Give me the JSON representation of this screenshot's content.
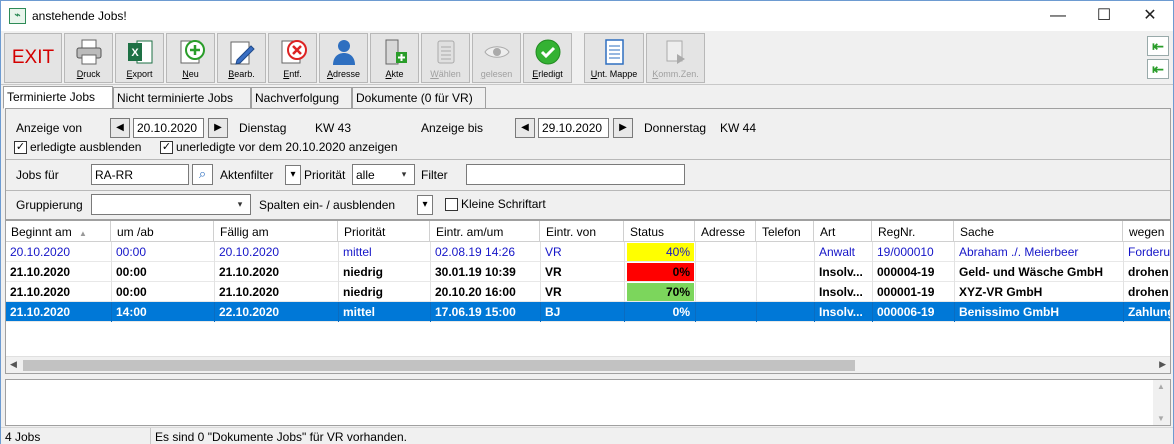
{
  "window": {
    "title": "anstehende Jobs!",
    "minimize_glyph": "—",
    "maximize_glyph": "☐",
    "close_glyph": "✕"
  },
  "toolbar": {
    "exit_label": "EXIT",
    "buttons": [
      {
        "label": "Druck",
        "icon": "printer-icon",
        "enabled": true
      },
      {
        "label": "Export",
        "icon": "excel-icon",
        "enabled": true
      },
      {
        "label": "Neu",
        "icon": "add-icon",
        "enabled": true
      },
      {
        "label": "Bearb.",
        "icon": "edit-icon",
        "enabled": true
      },
      {
        "label": "Entf.",
        "icon": "delete-icon",
        "enabled": true
      },
      {
        "label": "Adresse",
        "icon": "person-icon",
        "enabled": true
      },
      {
        "label": "Akte",
        "icon": "file-add-icon",
        "enabled": true
      },
      {
        "label": "Wählen",
        "icon": "dial-icon",
        "enabled": false
      },
      {
        "label": "gelesen",
        "icon": "eye-icon",
        "enabled": false
      },
      {
        "label": "Erledigt",
        "icon": "check-icon",
        "enabled": true
      },
      {
        "label": "Unt. Mappe",
        "icon": "folder-icon",
        "enabled": true
      },
      {
        "label": "Komm.Zen.",
        "icon": "comm-icon",
        "enabled": false
      }
    ],
    "side_arrow_top": "⇤",
    "side_arrow_bottom": "⇤"
  },
  "tabs": [
    {
      "label": "Terminierte Jobs",
      "active": true
    },
    {
      "label": "Nicht terminierte Jobs",
      "active": false
    },
    {
      "label": "Nachverfolgung",
      "active": false
    },
    {
      "label": "Dokumente (0 für VR)",
      "active": false
    }
  ],
  "filters": {
    "anzeige_von_label": "Anzeige von",
    "von_date": "20.10.2020",
    "von_weekday": "Dienstag",
    "von_week": "KW 43",
    "anzeige_bis_label": "Anzeige bis",
    "bis_date": "29.10.2020",
    "bis_weekday": "Donnerstag",
    "bis_week": "KW 44",
    "erledigte_ausblenden_label": "erledigte ausblenden",
    "erledigte_ausblenden_checked": true,
    "unerledigte_label": "unerledigte vor dem 20.10.2020 anzeigen",
    "unerledigte_checked": true,
    "jobs_fuer_label": "Jobs für",
    "jobs_fuer_value": "RA-RR",
    "aktenfilter_label": "Aktenfilter",
    "prioritaet_label": "Priorität",
    "prioritaet_value": "alle",
    "filter_label": "Filter",
    "filter_value": "",
    "gruppierung_label": "Gruppierung",
    "gruppierung_value": "",
    "spalten_label": "Spalten ein- / ausblenden",
    "kleine_schrift_label": "Kleine Schriftart",
    "kleine_schrift_checked": false,
    "left_arrow": "◀",
    "right_arrow": "▶",
    "dropdown_glyph": "▾",
    "checkmark": "✓",
    "search_glyph": "⌕"
  },
  "table": {
    "columns": [
      "Beginnt am",
      "um /ab",
      "Fällig am",
      "Priorität",
      "Eintr. am/um",
      "Eintr. von",
      "Status",
      "Adresse",
      "Telefon",
      "Art",
      "RegNr.",
      "Sache",
      "wegen"
    ],
    "sort_glyph": "▲",
    "rows": [
      {
        "style": "blue",
        "beginnt": "20.10.2020",
        "um": "00:00",
        "faellig": "20.10.2020",
        "prio": "mittel",
        "eintr_am": "02.08.19 14:26",
        "eintr_von": "VR",
        "status": "40%",
        "status_pct": 40,
        "status_color": "#ffff00",
        "adresse": "",
        "telefon": "",
        "art": "Anwalt",
        "regnr": "19/000010",
        "sache": "Abraham ./. Meierbeer",
        "wegen": "Forderu"
      },
      {
        "style": "bold",
        "beginnt": "21.10.2020",
        "um": "00:00",
        "faellig": "21.10.2020",
        "prio": "niedrig",
        "eintr_am": "30.01.19 10:39",
        "eintr_von": "VR",
        "status": "0%",
        "status_pct": 0,
        "status_color": "#ff0000",
        "adresse": "",
        "telefon": "",
        "art": "Insolv...",
        "regnr": "000004-19",
        "sache": "Geld- und Wäsche GmbH",
        "wegen": "drohen"
      },
      {
        "style": "bold",
        "beginnt": "21.10.2020",
        "um": "00:00",
        "faellig": "21.10.2020",
        "prio": "niedrig",
        "eintr_am": "20.10.20 16:00",
        "eintr_von": "VR",
        "status": "70%",
        "status_pct": 70,
        "status_color": "#7cd65c",
        "adresse": "",
        "telefon": "",
        "art": "Insolv...",
        "regnr": "000001-19",
        "sache": "XYZ-VR GmbH",
        "wegen": "drohen"
      },
      {
        "style": "sel",
        "beginnt": "21.10.2020",
        "um": "14:00",
        "faellig": "22.10.2020",
        "prio": "mittel",
        "eintr_am": "17.06.19 15:00",
        "eintr_von": "BJ",
        "status": "0%",
        "status_pct": 0,
        "status_color": "",
        "adresse": "",
        "telefon": "",
        "art": "Insolv...",
        "regnr": "000006-19",
        "sache": "Benissimo GmbH",
        "wegen": "Zahlung"
      }
    ]
  },
  "scroll": {
    "left_glyph": "◀",
    "right_glyph": "▶",
    "up_glyph": "▲",
    "down_glyph": "▼"
  },
  "statusbar": {
    "count": "4 Jobs",
    "message": "Es sind 0 \"Dokumente Jobs\" für VR vorhanden."
  }
}
